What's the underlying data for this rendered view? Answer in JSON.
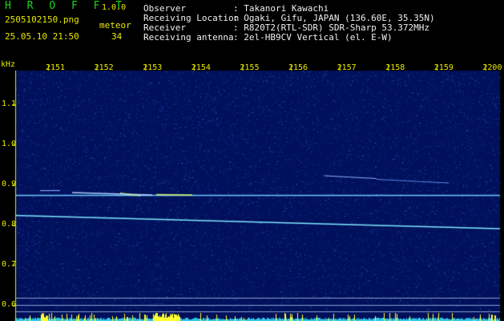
{
  "header": {
    "app_name": "H R O F F T",
    "version": "1.0.0",
    "filename": "2505102150.png",
    "datetime": "25.05.10 21:50",
    "meteor_label": "meteor",
    "meteor_count": "34",
    "rows": [
      {
        "label": "Observer",
        "value": ": Takanori Kawachi"
      },
      {
        "label": "Receiving Location",
        "value": ": Ogaki, Gifu, JAPAN (136.60E, 35.35N)"
      },
      {
        "label": "Receiver",
        "value": ": R820T2(RTL-SDR) SDR-Sharp 53.372MHz"
      },
      {
        "label": "Receiving antenna",
        "value": ": 2el-HB9CV Vertical (el. E-W)"
      }
    ]
  },
  "chart_data": {
    "type": "heatmap",
    "y_unit": "kHz",
    "x_ticks": [
      "2151",
      "2152",
      "2153",
      "2154",
      "2155",
      "2156",
      "2157",
      "2158",
      "2159",
      "2200"
    ],
    "y_ticks": [
      "1.1",
      "1.0",
      "0.9",
      "0.8",
      "0.7",
      "0.6"
    ],
    "ylim": [
      0.58,
      1.17
    ],
    "xlim": [
      "2150",
      "2200"
    ],
    "colors": {
      "background": "#00105a",
      "noise": "#1c3ca0",
      "signal": "#8ef0ff",
      "activity_bar": "#ffff30"
    }
  }
}
